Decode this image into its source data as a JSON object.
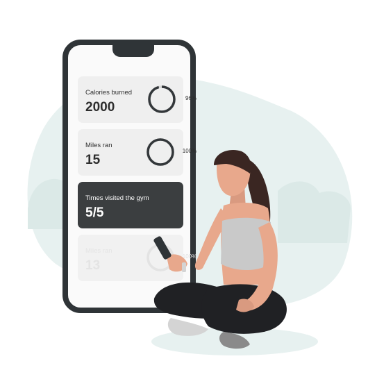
{
  "colors": {
    "blob": "#e7f1f0",
    "phone_frame": "#2f3437",
    "card_bg": "#efefef",
    "card_dark": "#3b3e40",
    "ring_track": "#d9d9d9",
    "ring_fill": "#33373a",
    "skin": "#e8a88c",
    "hair": "#3a2622",
    "pants": "#202124",
    "top": "#c9c9c9"
  },
  "cards": [
    {
      "label": "Calories burned",
      "value": "2000",
      "ring": {
        "text": "96%",
        "progress": 0.96
      }
    },
    {
      "label": "Miles ran",
      "value": "15",
      "ring": {
        "text": "100%",
        "progress": 1.0
      }
    },
    {
      "label": "Times visited the gym",
      "value": "5/5"
    },
    {
      "label": "Miles ran",
      "value": "13",
      "ring": {
        "text": "100%",
        "progress": 1.0
      }
    }
  ]
}
